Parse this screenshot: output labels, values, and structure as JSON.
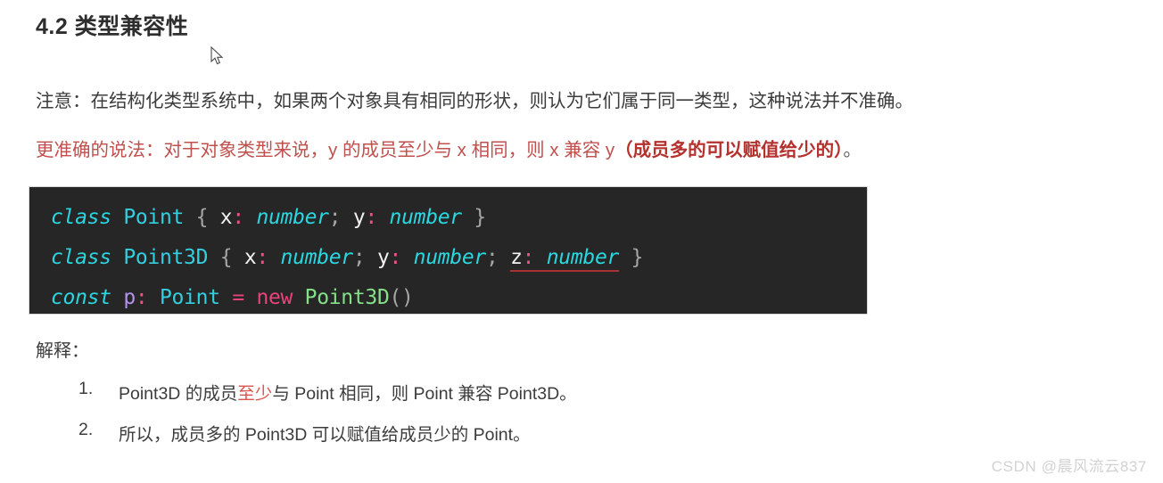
{
  "document": {
    "heading": "4.2 类型兼容性",
    "paragraph_note": "注意：在结构化类型系统中，如果两个对象具有相同的形状，则认为它们属于同一类型，这种说法并不准确。",
    "paragraph_accurate": {
      "lead": "更准确的说法：对于对象类型来说，y 的成员至少与 x 相同，则 x 兼容 y",
      "emphasis": "（成员多的可以赋值给少的）",
      "tail": "。"
    },
    "explain_label": "解释："
  },
  "code": {
    "language": "typescript",
    "background": "#262626",
    "lines": [
      {
        "tokens": [
          {
            "text": "class",
            "cls": "kw"
          },
          {
            "text": " ",
            "cls": "plain"
          },
          {
            "text": "Point",
            "cls": "cls"
          },
          {
            "text": " ",
            "cls": "plain"
          },
          {
            "text": "{",
            "cls": "brace"
          },
          {
            "text": " ",
            "cls": "plain"
          },
          {
            "text": "x",
            "cls": "prop"
          },
          {
            "text": ":",
            "cls": "colon"
          },
          {
            "text": " ",
            "cls": "plain"
          },
          {
            "text": "number",
            "cls": "typ"
          },
          {
            "text": ";",
            "cls": "semi"
          },
          {
            "text": " ",
            "cls": "plain"
          },
          {
            "text": "y",
            "cls": "prop"
          },
          {
            "text": ":",
            "cls": "colon"
          },
          {
            "text": " ",
            "cls": "plain"
          },
          {
            "text": "number",
            "cls": "typ"
          },
          {
            "text": " ",
            "cls": "plain"
          },
          {
            "text": "}",
            "cls": "brace"
          }
        ]
      },
      {
        "tokens": [
          {
            "text": "class",
            "cls": "kw"
          },
          {
            "text": " ",
            "cls": "plain"
          },
          {
            "text": "Point3D",
            "cls": "cls"
          },
          {
            "text": " ",
            "cls": "plain"
          },
          {
            "text": "{",
            "cls": "brace"
          },
          {
            "text": " ",
            "cls": "plain"
          },
          {
            "text": "x",
            "cls": "prop"
          },
          {
            "text": ":",
            "cls": "colon"
          },
          {
            "text": " ",
            "cls": "plain"
          },
          {
            "text": "number",
            "cls": "typ"
          },
          {
            "text": ";",
            "cls": "semi"
          },
          {
            "text": " ",
            "cls": "plain"
          },
          {
            "text": "y",
            "cls": "prop"
          },
          {
            "text": ":",
            "cls": "colon"
          },
          {
            "text": " ",
            "cls": "plain"
          },
          {
            "text": "number",
            "cls": "typ"
          },
          {
            "text": ";",
            "cls": "semi"
          },
          {
            "text": " ",
            "cls": "plain"
          },
          {
            "text": "z",
            "cls": "prop",
            "error": true
          },
          {
            "text": ":",
            "cls": "colon",
            "error": true
          },
          {
            "text": " ",
            "cls": "plain",
            "error": true
          },
          {
            "text": "number",
            "cls": "typ",
            "error": true
          },
          {
            "text": " ",
            "cls": "plain"
          },
          {
            "text": "}",
            "cls": "brace"
          }
        ]
      },
      {
        "tokens": [
          {
            "text": "const",
            "cls": "kw"
          },
          {
            "text": " ",
            "cls": "plain"
          },
          {
            "text": "p",
            "cls": "varname"
          },
          {
            "text": ":",
            "cls": "colon"
          },
          {
            "text": " ",
            "cls": "plain"
          },
          {
            "text": "Point",
            "cls": "cls"
          },
          {
            "text": " ",
            "cls": "plain"
          },
          {
            "text": "=",
            "cls": "op"
          },
          {
            "text": " ",
            "cls": "plain"
          },
          {
            "text": "new",
            "cls": "newkw"
          },
          {
            "text": " ",
            "cls": "plain"
          },
          {
            "text": "Point3D",
            "cls": "ctor"
          },
          {
            "text": "()",
            "cls": "paren"
          }
        ]
      }
    ]
  },
  "explanation_list": [
    {
      "marker": "1.",
      "segments": [
        {
          "text": "Point3D 的成员",
          "highlight": false
        },
        {
          "text": "至少",
          "highlight": true
        },
        {
          "text": "与 Point 相同，则 Point 兼容 Point3D。",
          "highlight": false
        }
      ]
    },
    {
      "marker": "2.",
      "segments": [
        {
          "text": "所以，成员多的 Point3D 可以赋值给成员少的 Point。",
          "highlight": false
        }
      ]
    }
  ],
  "watermark": {
    "text": "CSDN @晨风流云837"
  },
  "colors": {
    "accent_red": "#c0504d",
    "strong_red": "#b5312e",
    "highlight_red": "#d9534f",
    "code_bg": "#262626",
    "keyword_cyan": "#2ad6e0",
    "error_underline": "#a83232"
  }
}
